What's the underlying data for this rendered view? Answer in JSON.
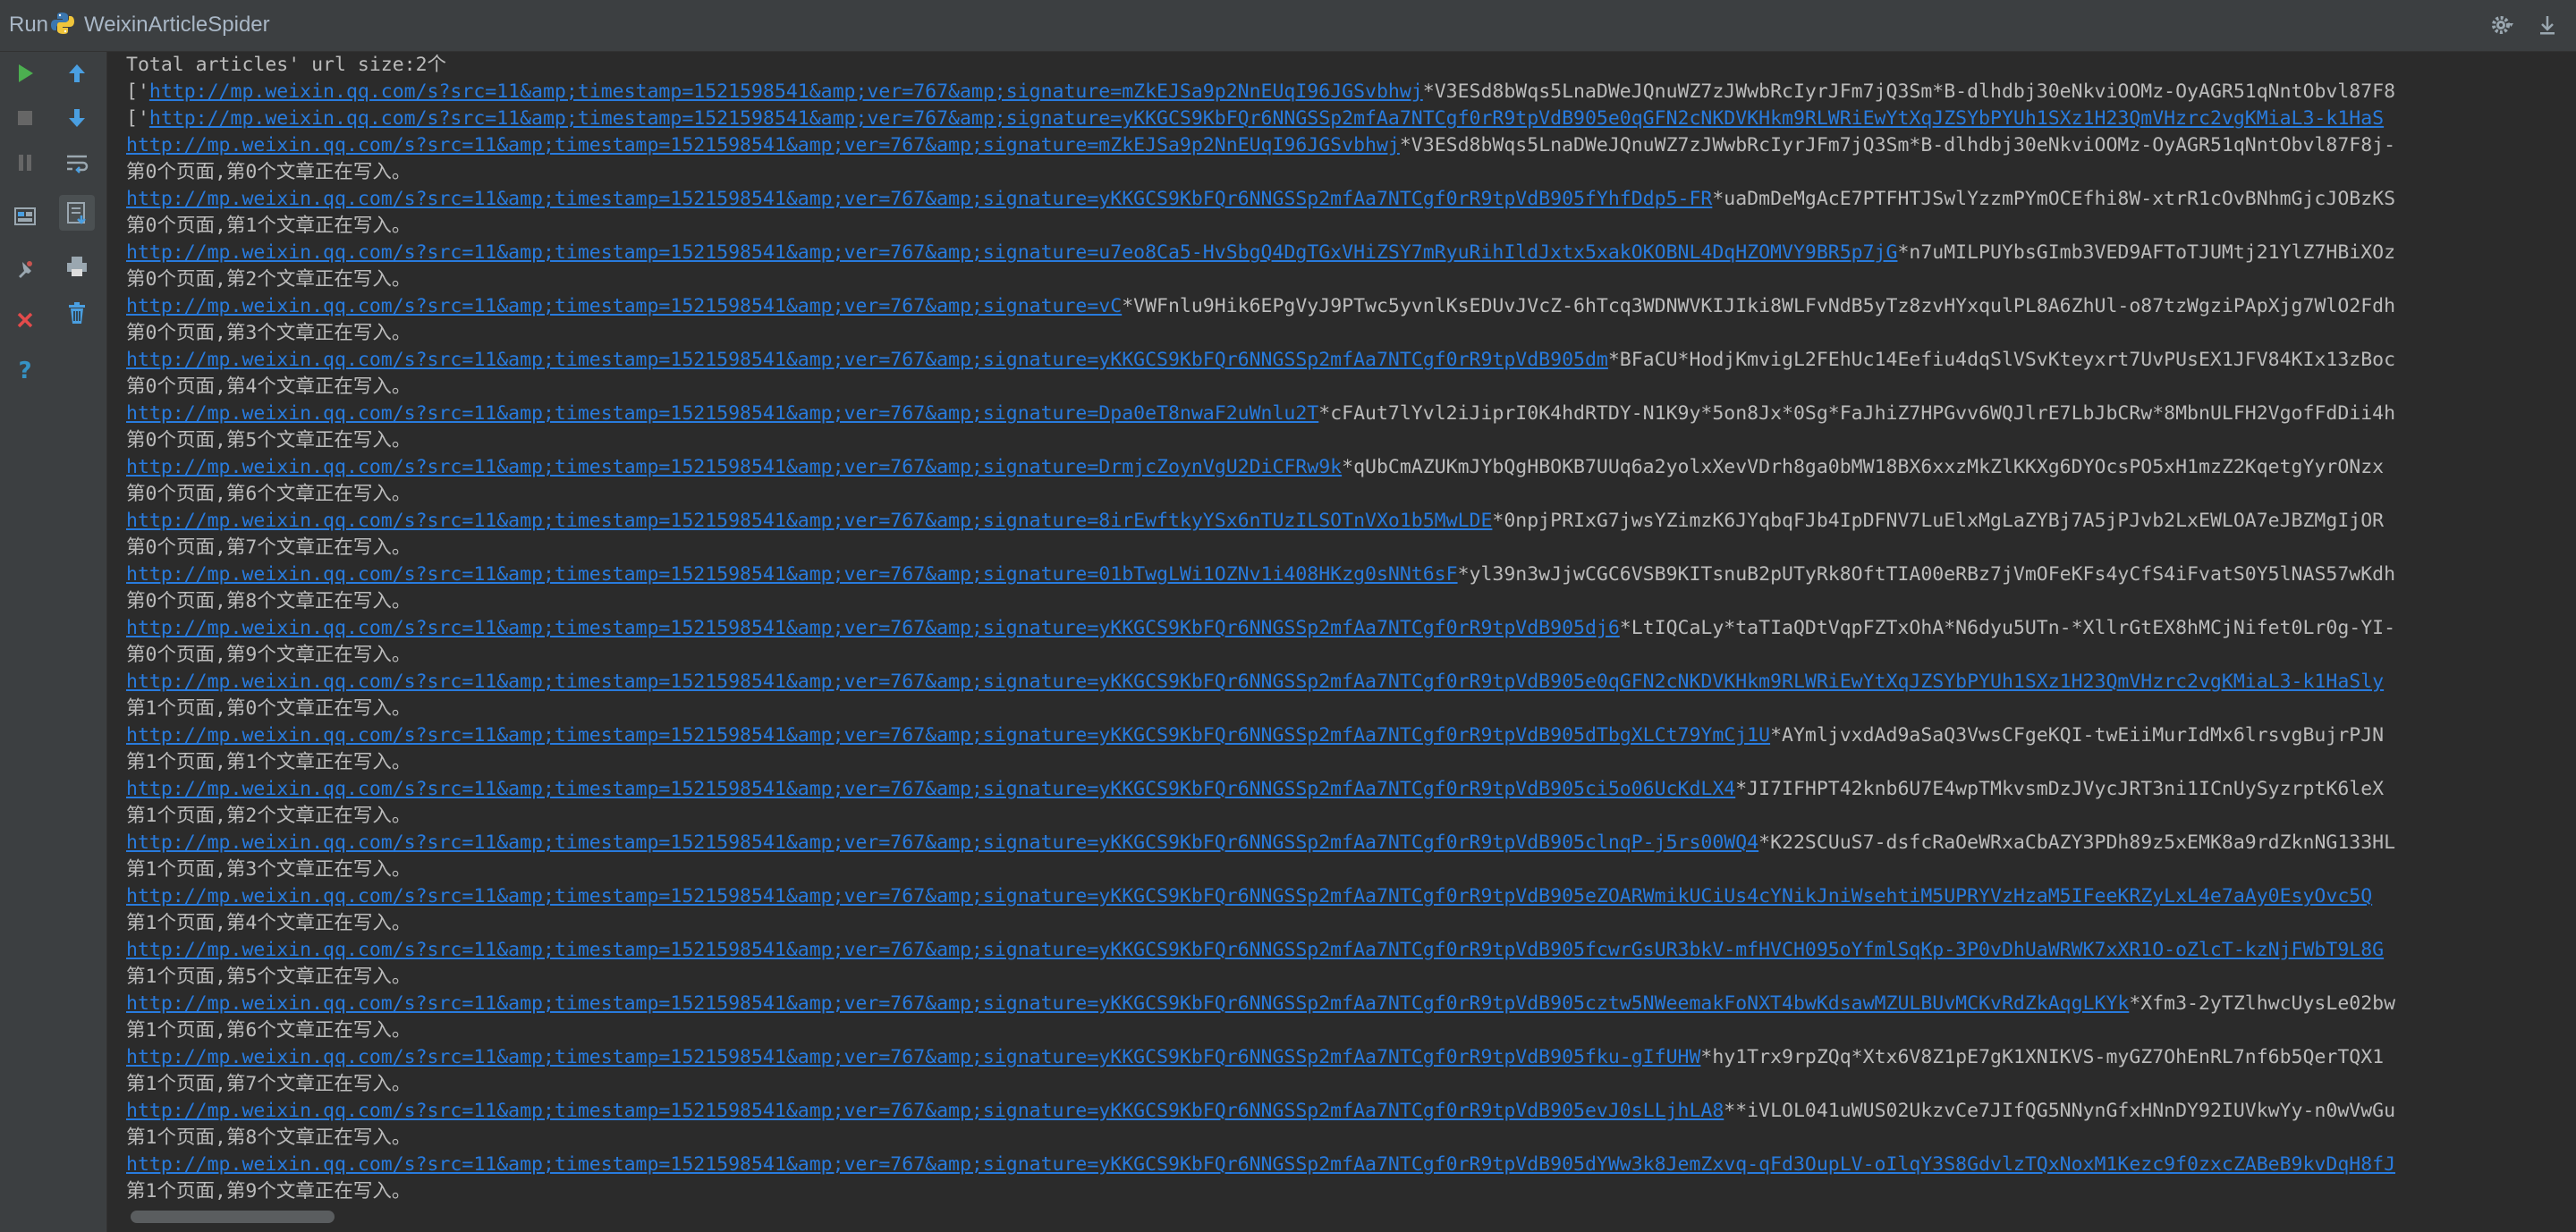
{
  "header": {
    "run_label": "Run",
    "config_name": "WeixinArticleSpider",
    "icons": [
      "python-icon",
      "gear-icon",
      "pin-icon"
    ]
  },
  "toolbar": {
    "buttons": [
      {
        "name": "rerun-icon",
        "color": "#4caf50"
      },
      {
        "name": "stop-icon",
        "color": "#777777"
      },
      {
        "name": "pause-icon",
        "color": "#777777"
      },
      {
        "name": "dump-threads-icon",
        "color": "#9aa7b0"
      },
      {
        "name": "pin-tab-icon",
        "color": "#9aa7b0"
      },
      {
        "name": "close-icon",
        "color": "#e34b4b"
      },
      {
        "name": "help-icon",
        "color": "#3592c4"
      },
      {
        "name": "up-arrow-icon",
        "color": "#4a9fe1"
      },
      {
        "name": "down-arrow-icon",
        "color": "#4a9fe1"
      },
      {
        "name": "soft-wrap-icon",
        "color": "#9aa7b0"
      },
      {
        "name": "scroll-to-end-icon",
        "color": "#9aa7b0"
      },
      {
        "name": "print-icon",
        "color": "#9aa7b0"
      },
      {
        "name": "trash-icon",
        "color": "#4a9fe1"
      }
    ]
  },
  "console": {
    "lines": [
      {
        "text": "Total articles' url size:2个"
      },
      {
        "prefix": "['",
        "link": "http://mp.weixin.qq.com/s?src=11&amp;timestamp=1521598541&amp;ver=767&amp;signature=mZkEJSa9p2NnEUqI96JGSvbhwj",
        "suffix": "*V3ESd8bWqs5LnaDWeJQnuWZ7zJWwbRcIyrJFm7jQ3Sm*B-dlhdbj30eNkviOOMz-OyAGR51qNntObvl87F8"
      },
      {
        "prefix": "['",
        "link": "http://mp.weixin.qq.com/s?src=11&amp;timestamp=1521598541&amp;ver=767&amp;signature=yKKGCS9KbFQr6NNGSSp2mfAa7NTCgf0rR9tpVdB905e0qGFN2cNKDVKHkm9RLWRiEwYtXqJZSYbPYUh1SXz1H23QmVHzrc2vgKMiaL3-k1HaS",
        "suffix": ""
      },
      {
        "link": "http://mp.weixin.qq.com/s?src=11&amp;timestamp=1521598541&amp;ver=767&amp;signature=mZkEJSa9p2NnEUqI96JGSvbhwj",
        "suffix": "*V3ESd8bWqs5LnaDWeJQnuWZ7zJWwbRcIyrJFm7jQ3Sm*B-dlhdbj30eNkviOOMz-OyAGR51qNntObvl87F8j-"
      },
      {
        "text": "第0个页面,第0个文章正在写入。"
      },
      {
        "link": "http://mp.weixin.qq.com/s?src=11&amp;timestamp=1521598541&amp;ver=767&amp;signature=yKKGCS9KbFQr6NNGSSp2mfAa7NTCgf0rR9tpVdB905fYhfDdp5-FR",
        "suffix": "*uaDmDeMgAcE7PTFHTJSwlYzzmPYmOCEfhi8W-xtrR1cOvBNhmGjcJOBzKS"
      },
      {
        "text": "第0个页面,第1个文章正在写入。"
      },
      {
        "link": "http://mp.weixin.qq.com/s?src=11&amp;timestamp=1521598541&amp;ver=767&amp;signature=u7eo8Ca5-HvSbgQ4DgTGxVHiZSY7mRyuRihIldJxtx5xakOKOBNL4DqHZOMVY9BR5p7jG",
        "suffix": "*n7uMILPUYbsGImb3VED9AFToTJUMtj21YlZ7HBiXOz"
      },
      {
        "text": "第0个页面,第2个文章正在写入。"
      },
      {
        "link": "http://mp.weixin.qq.com/s?src=11&amp;timestamp=1521598541&amp;ver=767&amp;signature=vC",
        "suffix": "*VWFnlu9Hik6EPgVyJ9PTwc5yvnlKsEDUvJVcZ-6hTcq3WDNWVKIJIki8WLFvNdB5yTz8zvHYxqulPL8A6ZhUl-o87tzWgziPApXjg7WlO2Fdh"
      },
      {
        "text": "第0个页面,第3个文章正在写入。"
      },
      {
        "link": "http://mp.weixin.qq.com/s?src=11&amp;timestamp=1521598541&amp;ver=767&amp;signature=yKKGCS9KbFQr6NNGSSp2mfAa7NTCgf0rR9tpVdB905dm",
        "suffix": "*BFaCU*HodjKmvigL2FEhUc14Eefiu4dqSlVSvKteyxrt7UvPUsEX1JFV84KIx13zBoc"
      },
      {
        "text": "第0个页面,第4个文章正在写入。"
      },
      {
        "link": "http://mp.weixin.qq.com/s?src=11&amp;timestamp=1521598541&amp;ver=767&amp;signature=Dpa0eT8nwaF2uWnlu2T",
        "suffix": "*cFAut7lYvl2iJiprI0K4hdRTDY-N1K9y*5on8Jx*0Sg*FaJhiZ7HPGvv6WQJlrE7LbJbCRw*8MbnULFH2VgofFdDii4h"
      },
      {
        "text": "第0个页面,第5个文章正在写入。"
      },
      {
        "link": "http://mp.weixin.qq.com/s?src=11&amp;timestamp=1521598541&amp;ver=767&amp;signature=DrmjcZoynVgU2DiCFRw9k",
        "suffix": "*qUbCmAZUKmJYbQgHBOKB7UUq6a2yolxXevVDrh8ga0bMW18BX6xxzMkZlKKXg6DYOcsPO5xH1mzZ2KqetgYyrONzx"
      },
      {
        "text": "第0个页面,第6个文章正在写入。"
      },
      {
        "link": "http://mp.weixin.qq.com/s?src=11&amp;timestamp=1521598541&amp;ver=767&amp;signature=8irEwftkyYSx6nTUzILSOTnVXo1b5MwLDE",
        "suffix": "*0npjPRIxG7jwsYZimzK6JYqbqFJb4IpDFNV7LuElxMgLaZYBj7A5jPJvb2LxEWLOA7eJBZMgIjOR"
      },
      {
        "text": "第0个页面,第7个文章正在写入。"
      },
      {
        "link": "http://mp.weixin.qq.com/s?src=11&amp;timestamp=1521598541&amp;ver=767&amp;signature=01bTwgLWi1OZNv1i408HKzg0sNNt6sF",
        "suffix": "*yl39n3wJjwCGC6VSB9KITsnuB2pUTyRk8OftTIA00eRBz7jVmOFeKFs4yCfS4iFvatS0Y5lNAS57wKdh"
      },
      {
        "text": "第0个页面,第8个文章正在写入。"
      },
      {
        "link": "http://mp.weixin.qq.com/s?src=11&amp;timestamp=1521598541&amp;ver=767&amp;signature=yKKGCS9KbFQr6NNGSSp2mfAa7NTCgf0rR9tpVdB905dj6",
        "suffix": "*LtIQCaLy*taTIaQDtVqpFZTxOhA*N6dyu5UTn-*XllrGtEX8hMCjNifet0Lr0g-YI-"
      },
      {
        "text": "第0个页面,第9个文章正在写入。"
      },
      {
        "link": "http://mp.weixin.qq.com/s?src=11&amp;timestamp=1521598541&amp;ver=767&amp;signature=yKKGCS9KbFQr6NNGSSp2mfAa7NTCgf0rR9tpVdB905e0qGFN2cNKDVKHkm9RLWRiEwYtXqJZSYbPYUh1SXz1H23QmVHzrc2vgKMiaL3-k1HaSly",
        "suffix": ""
      },
      {
        "text": "第1个页面,第0个文章正在写入。"
      },
      {
        "link": "http://mp.weixin.qq.com/s?src=11&amp;timestamp=1521598541&amp;ver=767&amp;signature=yKKGCS9KbFQr6NNGSSp2mfAa7NTCgf0rR9tpVdB905dTbgXLCt79YmCj1U",
        "suffix": "*AYmljvxdAd9aSaQ3VwsCFgeKQI-twEiiMurIdMx6lrsvgBujrPJN"
      },
      {
        "text": "第1个页面,第1个文章正在写入。"
      },
      {
        "link": "http://mp.weixin.qq.com/s?src=11&amp;timestamp=1521598541&amp;ver=767&amp;signature=yKKGCS9KbFQr6NNGSSp2mfAa7NTCgf0rR9tpVdB905ci5o06UcKdLX4",
        "suffix": "*JI7IFHPT42knb6U7E4wpTMkvsmDzJVycJRT3ni1ICnUySyzrptK6leX"
      },
      {
        "text": "第1个页面,第2个文章正在写入。"
      },
      {
        "link": "http://mp.weixin.qq.com/s?src=11&amp;timestamp=1521598541&amp;ver=767&amp;signature=yKKGCS9KbFQr6NNGSSp2mfAa7NTCgf0rR9tpVdB905clnqP-j5rs00WQ4",
        "suffix": "*K22SCUuS7-dsfcRaOeWRxaCbAZY3PDh89z5xEMK8a9rdZknNG133HL"
      },
      {
        "text": "第1个页面,第3个文章正在写入。"
      },
      {
        "link": "http://mp.weixin.qq.com/s?src=11&amp;timestamp=1521598541&amp;ver=767&amp;signature=yKKGCS9KbFQr6NNGSSp2mfAa7NTCgf0rR9tpVdB905eZOARWmikUCiUs4cYNikJniWsehtiM5UPRYVzHzaM5IFeeKRZyLxL4e7aAy0EsyOvc5Q",
        "suffix": ""
      },
      {
        "text": "第1个页面,第4个文章正在写入。"
      },
      {
        "link": "http://mp.weixin.qq.com/s?src=11&amp;timestamp=1521598541&amp;ver=767&amp;signature=yKKGCS9KbFQr6NNGSSp2mfAa7NTCgf0rR9tpVdB905fcwrGsUR3bkV-mfHVCH095oYfmlSqKp-3P0vDhUaWRWK7xXR1O-oZlcT-kzNjFWbT9L8G",
        "suffix": ""
      },
      {
        "text": "第1个页面,第5个文章正在写入。"
      },
      {
        "link": "http://mp.weixin.qq.com/s?src=11&amp;timestamp=1521598541&amp;ver=767&amp;signature=yKKGCS9KbFQr6NNGSSp2mfAa7NTCgf0rR9tpVdB905cztw5NWeemakFoNXT4bwKdsawMZULBUvMCKvRdZkAqgLKYk",
        "suffix": "*Xfm3-2yTZlhwcUysLe02bw"
      },
      {
        "text": "第1个页面,第6个文章正在写入。"
      },
      {
        "link": "http://mp.weixin.qq.com/s?src=11&amp;timestamp=1521598541&amp;ver=767&amp;signature=yKKGCS9KbFQr6NNGSSp2mfAa7NTCgf0rR9tpVdB905fku-gIfUHW",
        "suffix": "*hy1Trx9rpZQq*Xtx6V8Z1pE7gK1XNIKVS-myGZ7OhEnRL7nf6b5QerTQX1"
      },
      {
        "text": "第1个页面,第7个文章正在写入。"
      },
      {
        "link": "http://mp.weixin.qq.com/s?src=11&amp;timestamp=1521598541&amp;ver=767&amp;signature=yKKGCS9KbFQr6NNGSSp2mfAa7NTCgf0rR9tpVdB905evJ0sLLjhLA8",
        "suffix": "**iVLOL041uWUS02UkzvCe7JIfQG5NNynGfxHNnDY92IUVkwYy-n0wVwGu"
      },
      {
        "text": "第1个页面,第8个文章正在写入。"
      },
      {
        "link": "http://mp.weixin.qq.com/s?src=11&amp;timestamp=1521598541&amp;ver=767&amp;signature=yKKGCS9KbFQr6NNGSSp2mfAa7NTCgf0rR9tpVdB905dYWw3k8JemZxvq-qFd3OupLV-oIlqY3S8GdvlzTQxNoxM1Kezc9f0zxcZABeB9kvDqH8fJ",
        "suffix": ""
      },
      {
        "text": "第1个页面,第9个文章正在写入。"
      }
    ]
  },
  "colors": {
    "background": "#2b2b2b",
    "panel": "#3c3f41",
    "text": "#bbbbbb",
    "link": "#287bde",
    "run_green": "#4caf50",
    "close_red": "#e34b4b"
  }
}
